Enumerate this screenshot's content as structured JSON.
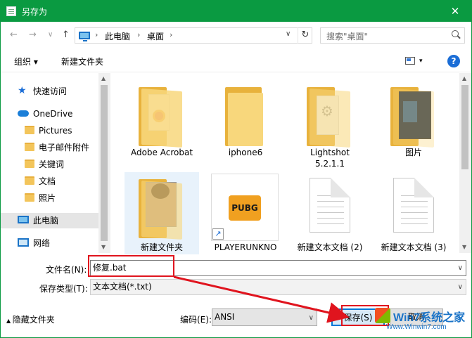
{
  "window": {
    "title": "另存为",
    "close_label": "✕"
  },
  "nav": {
    "back": "←",
    "forward": "→",
    "recent": "∨",
    "up": "↑"
  },
  "address": {
    "crumbs": [
      "此电脑",
      "桌面"
    ],
    "separator": "›",
    "dropdown": "∨",
    "refresh": "↻"
  },
  "search": {
    "placeholder": "搜索\"桌面\""
  },
  "toolbar": {
    "organize": "组织 ▾",
    "new_folder": "新建文件夹",
    "view_menu": "▾",
    "help": "?"
  },
  "sidebar": {
    "items": [
      {
        "label": "快速访问",
        "icon": "star-icon"
      },
      {
        "label": "OneDrive",
        "icon": "cloud-icon"
      },
      {
        "label": "Pictures",
        "icon": "folder-icon"
      },
      {
        "label": "电子邮件附件",
        "icon": "folder-icon"
      },
      {
        "label": "关键词",
        "icon": "folder-icon"
      },
      {
        "label": "文档",
        "icon": "folder-icon"
      },
      {
        "label": "照片",
        "icon": "folder-icon"
      },
      {
        "label": "此电脑",
        "icon": "computer-icon"
      },
      {
        "label": "网络",
        "icon": "network-icon"
      }
    ]
  },
  "files": [
    {
      "name": "Adobe Acrobat",
      "type": "folder"
    },
    {
      "name": "iphone6",
      "type": "folder"
    },
    {
      "name": "Lightshot\n5.2.1.1",
      "type": "folder"
    },
    {
      "name": "图片",
      "type": "folder"
    },
    {
      "name": "新建文件夹",
      "type": "folder"
    },
    {
      "name": "PLAYERUNKNO",
      "type": "shortcut"
    },
    {
      "name": "新建文本文档 (2)",
      "type": "text"
    },
    {
      "name": "新建文本文档 (3)",
      "type": "text"
    }
  ],
  "form": {
    "filename_label": "文件名(N):",
    "filename_value": "修复.bat",
    "savetype_label": "保存类型(T):",
    "savetype_value": "文本文档(*.txt)",
    "hide_folders": "隐藏文件夹",
    "encoding_label": "编码(E):",
    "encoding_value": "ANSI",
    "save_button": "保存(S)",
    "cancel_button": "取消"
  },
  "watermark": {
    "text": "Win7系统之家",
    "url": "Www.Winwin7.com"
  },
  "colors": {
    "titlebar": "#0a9a41",
    "annotation": "#e0141e",
    "accent": "#0078d7"
  }
}
